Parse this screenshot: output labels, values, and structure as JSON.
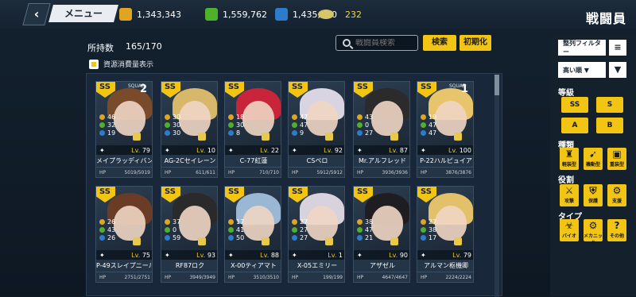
{
  "header": {
    "back_icon": "‹",
    "menu_label": "メニュー",
    "title": "戦闘員",
    "resources": [
      {
        "icon": "fuel-icon",
        "value": "1,343,343"
      },
      {
        "icon": "ammo-icon",
        "value": "1,559,762"
      },
      {
        "icon": "parts-icon",
        "value": "1,435,020"
      },
      {
        "icon": "coin-icon",
        "value": "232"
      }
    ]
  },
  "toolbar": {
    "count_label": "所持数",
    "count_value": "165/170",
    "cost_toggle_label": "資源消費量表示",
    "search_placeholder": "戦闘員検索",
    "search_button": "検索",
    "reset_button": "初期化"
  },
  "sidebar": {
    "filter_label": "整列フィルター",
    "sort_label": "高い順 ▼",
    "grade_header": "等級",
    "grades": [
      "SS",
      "S",
      "A",
      "B"
    ],
    "class_header": "種類",
    "classes": [
      "軽装型",
      "機動型",
      "重装型"
    ],
    "role_header": "役割",
    "roles": [
      "攻撃",
      "保護",
      "支援"
    ],
    "type_header": "タイプ",
    "types": [
      "バイオ",
      "メカニック",
      "その他"
    ]
  },
  "cards": [
    {
      "name": "メイプラッディバンサー",
      "lv": "79",
      "hp": "5019/5019",
      "stats": [
        "46",
        "32",
        "19"
      ],
      "squad": "SQUAD",
      "num": "2",
      "color": "#7a4b2a"
    },
    {
      "name": "AG-2Cセイレーン",
      "lv": "10",
      "hp": "611/611",
      "stats": [
        "30",
        "30",
        "30"
      ],
      "squad": "",
      "num": "",
      "color": "#d7b86a"
    },
    {
      "name": "C-77紅蓮",
      "lv": "22",
      "hp": "710/710",
      "stats": [
        "18",
        "30",
        "8"
      ],
      "squad": "",
      "num": "",
      "color": "#c8243a"
    },
    {
      "name": "CSペロ",
      "lv": "92",
      "hp": "5912/5912",
      "stats": [
        "47",
        "47",
        "9"
      ],
      "squad": "",
      "num": "",
      "color": "#d9d4e2"
    },
    {
      "name": "Mr.アルフレッド",
      "lv": "87",
      "hp": "3936/3936",
      "stats": [
        "43",
        "0",
        "27"
      ],
      "squad": "",
      "num": "",
      "color": "#2b2b2b"
    },
    {
      "name": "P-22ハルピュイア",
      "lv": "100",
      "hp": "3876/3876",
      "stats": [
        "19",
        "47",
        "47"
      ],
      "squad": "SQUAD",
      "num": "1",
      "color": "#e8c46c"
    },
    {
      "name": "P-49スレイプニール",
      "lv": "75",
      "hp": "2751/2751",
      "stats": [
        "26",
        "43",
        "26"
      ],
      "squad": "",
      "num": "",
      "color": "#6a3c26"
    },
    {
      "name": "RF87ロク",
      "lv": "93",
      "hp": "3949/3949",
      "stats": [
        "37",
        "0",
        "59"
      ],
      "squad": "",
      "num": "",
      "color": "#2a2a2a"
    },
    {
      "name": "X-00ティアマト",
      "lv": "88",
      "hp": "3510/3510",
      "stats": [
        "17",
        "41",
        "50"
      ],
      "squad": "",
      "num": "",
      "color": "#9ab7d4"
    },
    {
      "name": "X-05エミリー",
      "lv": "1",
      "hp": "199/199",
      "stats": [
        "27",
        "27",
        "27"
      ],
      "squad": "",
      "num": "",
      "color": "#d8d2dc"
    },
    {
      "name": "アザゼル",
      "lv": "90",
      "hp": "4647/4647",
      "stats": [
        "38",
        "47",
        "21"
      ],
      "squad": "",
      "num": "",
      "color": "#1e1e22"
    },
    {
      "name": "アルマン枢機卿",
      "lv": "79",
      "hp": "2224/2224",
      "stats": [
        "27",
        "38",
        "17"
      ],
      "squad": "",
      "num": "",
      "color": "#e2c16a"
    }
  ],
  "hp_label": "HP",
  "lv_label": "Lv."
}
